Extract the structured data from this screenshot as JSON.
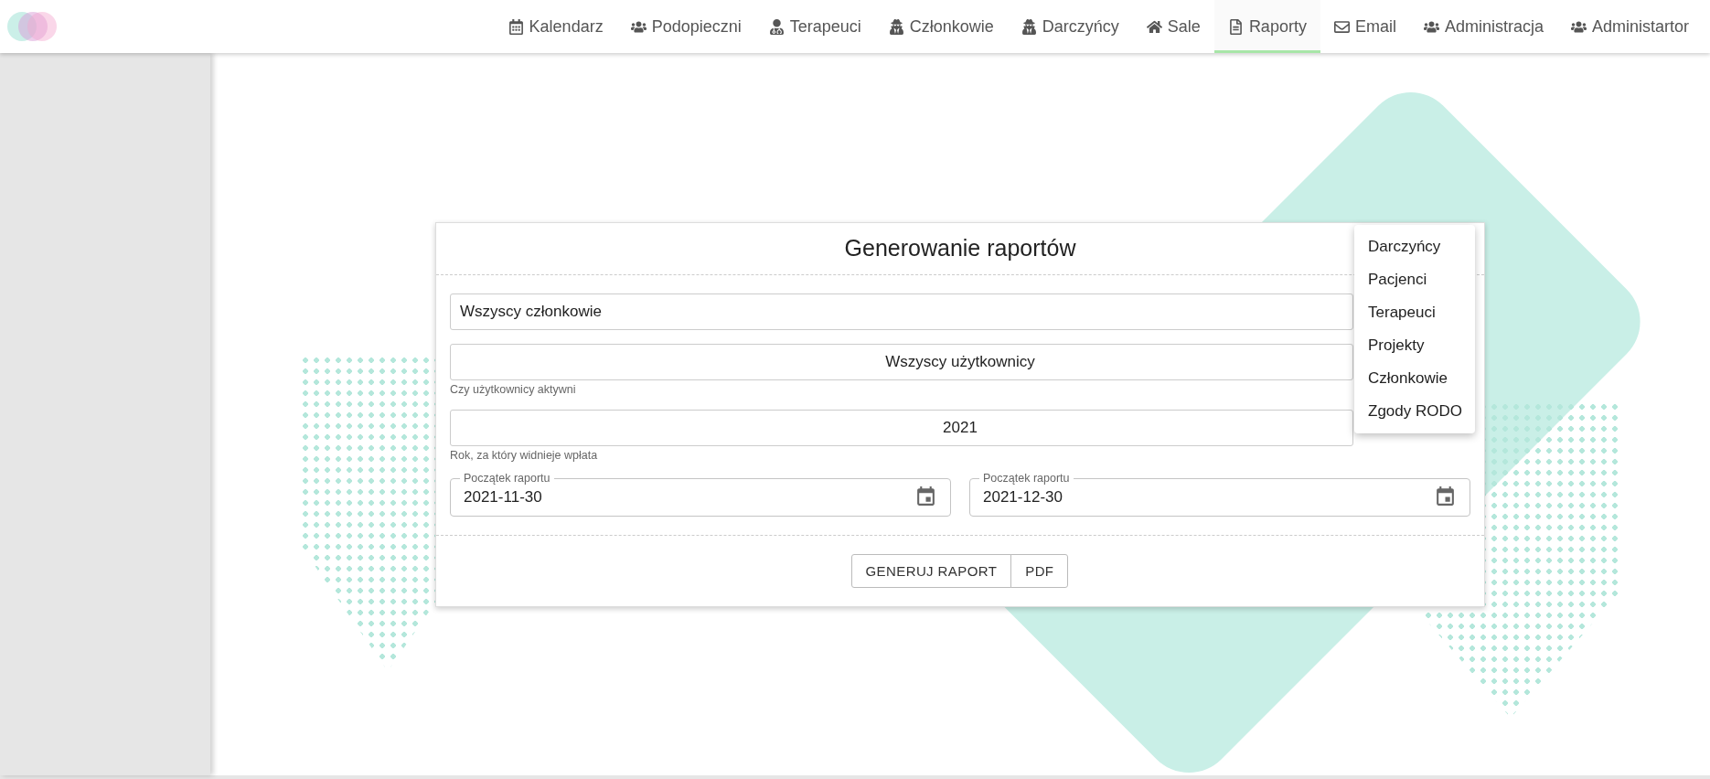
{
  "nav": {
    "items": [
      {
        "label": "Kalendarz",
        "selected": false
      },
      {
        "label": "Podopieczni",
        "selected": false
      },
      {
        "label": "Terapeuci",
        "selected": false
      },
      {
        "label": "Członkowie",
        "selected": false
      },
      {
        "label": "Darczyńcy",
        "selected": false
      },
      {
        "label": "Sale",
        "selected": false
      },
      {
        "label": "Raporty",
        "selected": true
      },
      {
        "label": "Email",
        "selected": false
      },
      {
        "label": "Administracja",
        "selected": false
      },
      {
        "label": "Administartor",
        "selected": false
      }
    ]
  },
  "card": {
    "title": "Generowanie raportów",
    "fields": [
      {
        "kind": "select",
        "value": "Wszyscy członkowie",
        "centered": false
      },
      {
        "kind": "select",
        "value": "Wszyscy użytkownicy",
        "centered": true,
        "helper": "Czy użytkownicy aktywni"
      },
      {
        "kind": "select",
        "value": "2021",
        "centered": true,
        "helper": "Rok, za który widnieje wpłata"
      }
    ],
    "dates": [
      {
        "label": "Początek raportu",
        "value": "2021-11-30"
      },
      {
        "label": "Początek raportu",
        "value": "2021-12-30"
      }
    ],
    "buttons": [
      "GENERUJ RAPORT",
      "PDF"
    ],
    "menu": [
      "Darczyńcy",
      "Pacjenci",
      "Terapeuci",
      "Projekty",
      "Członkowie",
      "Zgody RODO"
    ]
  }
}
